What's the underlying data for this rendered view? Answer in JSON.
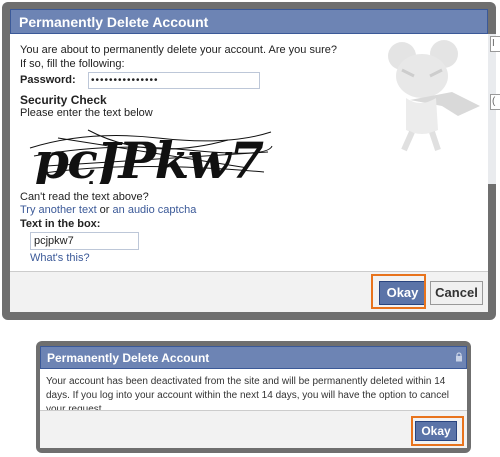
{
  "dialog1": {
    "title": "Permanently Delete Account",
    "intro_line1": "You are about to permanently delete your account. Are you sure?",
    "intro_line2": "If so, fill the following:",
    "password_label": "Password:",
    "password_value": "•••••••••••••••",
    "security_heading": "Security Check",
    "security_instruction": "Please enter the text below",
    "captcha_text": "pcJPkw7",
    "cant_read": "Can't read the text above?",
    "try_another": "Try another text",
    "or_text": " or ",
    "audio_captcha": "an audio captcha",
    "text_label": "Text in the box:",
    "text_value": "pcjpkw7",
    "whats_this": "What's this?",
    "okay_label": "Okay",
    "cancel_label": "Cancel"
  },
  "dialog2": {
    "title": "Permanently Delete Account",
    "message": "Your account has been deactivated from the site and will be permanently deleted within 14 days. If you log into your account within the next 14 days, you will have the option to cancel your request.",
    "okay_label": "Okay"
  },
  "colors": {
    "title_bar": "#6d84b4",
    "link": "#3b5998",
    "highlight": "#e8731c"
  }
}
